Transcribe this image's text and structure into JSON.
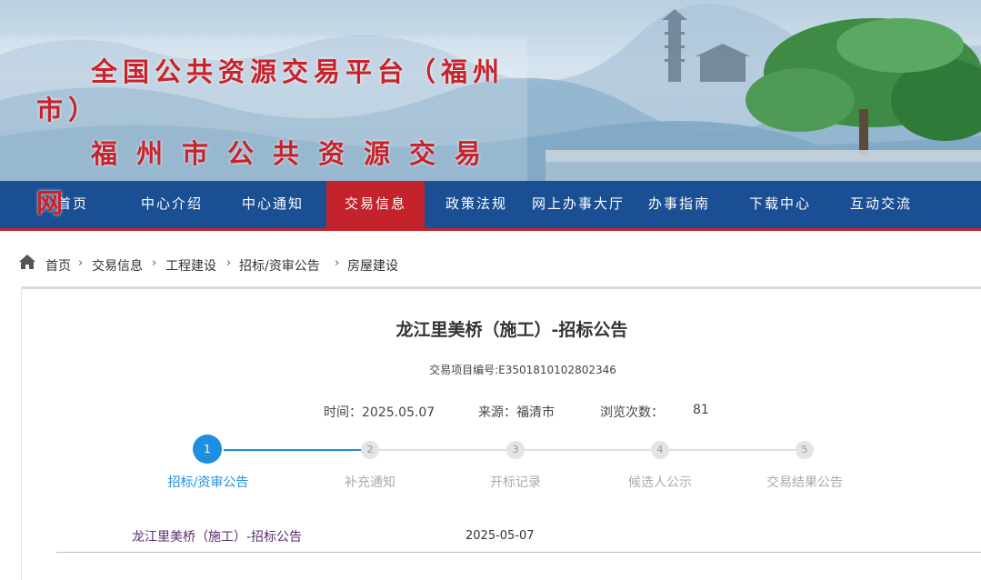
{
  "site": {
    "title_line1": "全国公共资源交易平台（福州",
    "title_line1_wrap": "市）",
    "title_line2": "福州市公共资源交易",
    "title_line2_wrap": "网"
  },
  "nav": {
    "items": [
      "首页",
      "中心介绍",
      "中心通知",
      "交易信息",
      "政策法规",
      "网上办事大厅",
      "办事指南",
      "下载中心",
      "互动交流"
    ],
    "active_index": 3
  },
  "breadcrumb": {
    "items": [
      "首页",
      "交易信息",
      "工程建设",
      "招标/资审公告",
      "房屋建设"
    ],
    "separator": "›"
  },
  "article": {
    "title": "龙江里美桥（施工）-招标公告",
    "project_code": "交易项目编号:E3501810102802346",
    "time_label": "时间：2025.05.07",
    "source_label": "来源：福清市",
    "views_label": "浏览次数：",
    "views": "81"
  },
  "steps": {
    "items": [
      {
        "num": "1",
        "label": "招标/资审公告"
      },
      {
        "num": "2",
        "label": "补充通知"
      },
      {
        "num": "3",
        "label": "开标记录"
      },
      {
        "num": "4",
        "label": "候选人公示"
      },
      {
        "num": "5",
        "label": "交易结果公告"
      }
    ],
    "active_index": 0
  },
  "list": {
    "items": [
      {
        "title": "龙江里美桥（施工）-招标公告",
        "date": "2025-05-07"
      }
    ]
  },
  "colors": {
    "nav_bg": "#1a4f93",
    "nav_active": "#c4232c",
    "title_red": "#c8232b",
    "step_active": "#1e8fe0"
  }
}
